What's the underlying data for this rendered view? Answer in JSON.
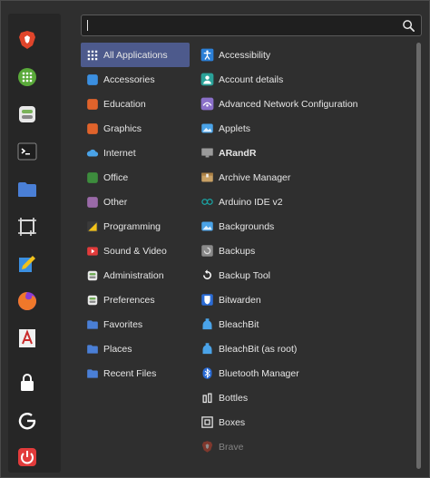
{
  "search": {
    "value": "",
    "placeholder": ""
  },
  "favorites": [
    {
      "name": "brave-icon",
      "color": "#e0452b"
    },
    {
      "name": "calculator-icon",
      "color": "#5aaa3a"
    },
    {
      "name": "settings-toggle-icon",
      "color": "#7ab35a"
    },
    {
      "name": "terminal-icon",
      "color": "#3a3a3a"
    },
    {
      "name": "folder-icon",
      "color": "#4a7fd6"
    },
    {
      "name": "screenshot-icon",
      "color": "#d8d8d8"
    },
    {
      "name": "text-editor-icon",
      "color": "#3b8fe0"
    },
    {
      "name": "firefox-icon",
      "color": "#f0782a"
    },
    {
      "name": "font-viewer-icon",
      "color": "#c92a2a"
    },
    {
      "name": "lock-icon",
      "color": "#ffffff"
    },
    {
      "name": "logout-icon",
      "color": "#ffffff"
    },
    {
      "name": "power-icon",
      "color": "#e23b3b"
    }
  ],
  "categories": [
    {
      "label": "All Applications",
      "icon": "grid-icon",
      "color": "#4d5a8c",
      "selected": true
    },
    {
      "label": "Accessories",
      "icon": "accessories-icon",
      "color": "#3b8fe0"
    },
    {
      "label": "Education",
      "icon": "education-icon",
      "color": "#e0632b"
    },
    {
      "label": "Graphics",
      "icon": "graphics-icon",
      "color": "#e0632b"
    },
    {
      "label": "Internet",
      "icon": "internet-icon",
      "color": "#4aa3e8"
    },
    {
      "label": "Office",
      "icon": "office-icon",
      "color": "#3d8c3d"
    },
    {
      "label": "Other",
      "icon": "other-icon",
      "color": "#9a6aa8"
    },
    {
      "label": "Programming",
      "icon": "programming-icon",
      "color": "#f2c21a"
    },
    {
      "label": "Sound & Video",
      "icon": "sound-video-icon",
      "color": "#e23b3b"
    },
    {
      "label": "Administration",
      "icon": "administration-icon",
      "color": "#cfcfcf"
    },
    {
      "label": "Preferences",
      "icon": "preferences-icon",
      "color": "#cfcfcf"
    },
    {
      "label": "Favorites",
      "icon": "favorites-folder-icon",
      "color": "#4a7fd6"
    },
    {
      "label": "Places",
      "icon": "places-folder-icon",
      "color": "#4a7fd6"
    },
    {
      "label": "Recent Files",
      "icon": "recent-files-icon",
      "color": "#4a7fd6"
    }
  ],
  "apps": [
    {
      "label": "Accessibility",
      "icon": "accessibility-icon",
      "color": "#2b7fd6"
    },
    {
      "label": "Account details",
      "icon": "account-details-icon",
      "color": "#2aa198"
    },
    {
      "label": "Advanced Network Configuration",
      "icon": "network-config-icon",
      "color": "#8a6fc8"
    },
    {
      "label": "Applets",
      "icon": "applets-icon",
      "color": "#4aa3e8"
    },
    {
      "label": "ARandR",
      "icon": "arandr-icon",
      "color": "#9a9a9a",
      "bold": true
    },
    {
      "label": "Archive Manager",
      "icon": "archive-manager-icon",
      "color": "#c8a064"
    },
    {
      "label": "Arduino IDE v2",
      "icon": "arduino-icon",
      "color": "#1aa3a3"
    },
    {
      "label": "Backgrounds",
      "icon": "backgrounds-icon",
      "color": "#4aa3e8"
    },
    {
      "label": "Backups",
      "icon": "backups-icon",
      "color": "#8a8a8a"
    },
    {
      "label": "Backup Tool",
      "icon": "backup-tool-icon",
      "color": "#ffffff"
    },
    {
      "label": "Bitwarden",
      "icon": "bitwarden-icon",
      "color": "#2b6cd6"
    },
    {
      "label": "BleachBit",
      "icon": "bleachbit-icon",
      "color": "#4aa3e8"
    },
    {
      "label": "BleachBit (as root)",
      "icon": "bleachbit-root-icon",
      "color": "#4aa3e8"
    },
    {
      "label": "Bluetooth Manager",
      "icon": "bluetooth-icon",
      "color": "#2b6cd6"
    },
    {
      "label": "Bottles",
      "icon": "bottles-icon",
      "color": "#e8e8e8"
    },
    {
      "label": "Boxes",
      "icon": "boxes-icon",
      "color": "#e8e8e8"
    },
    {
      "label": "Brave",
      "icon": "brave-app-icon",
      "color": "#e0452b",
      "dim": true
    }
  ]
}
